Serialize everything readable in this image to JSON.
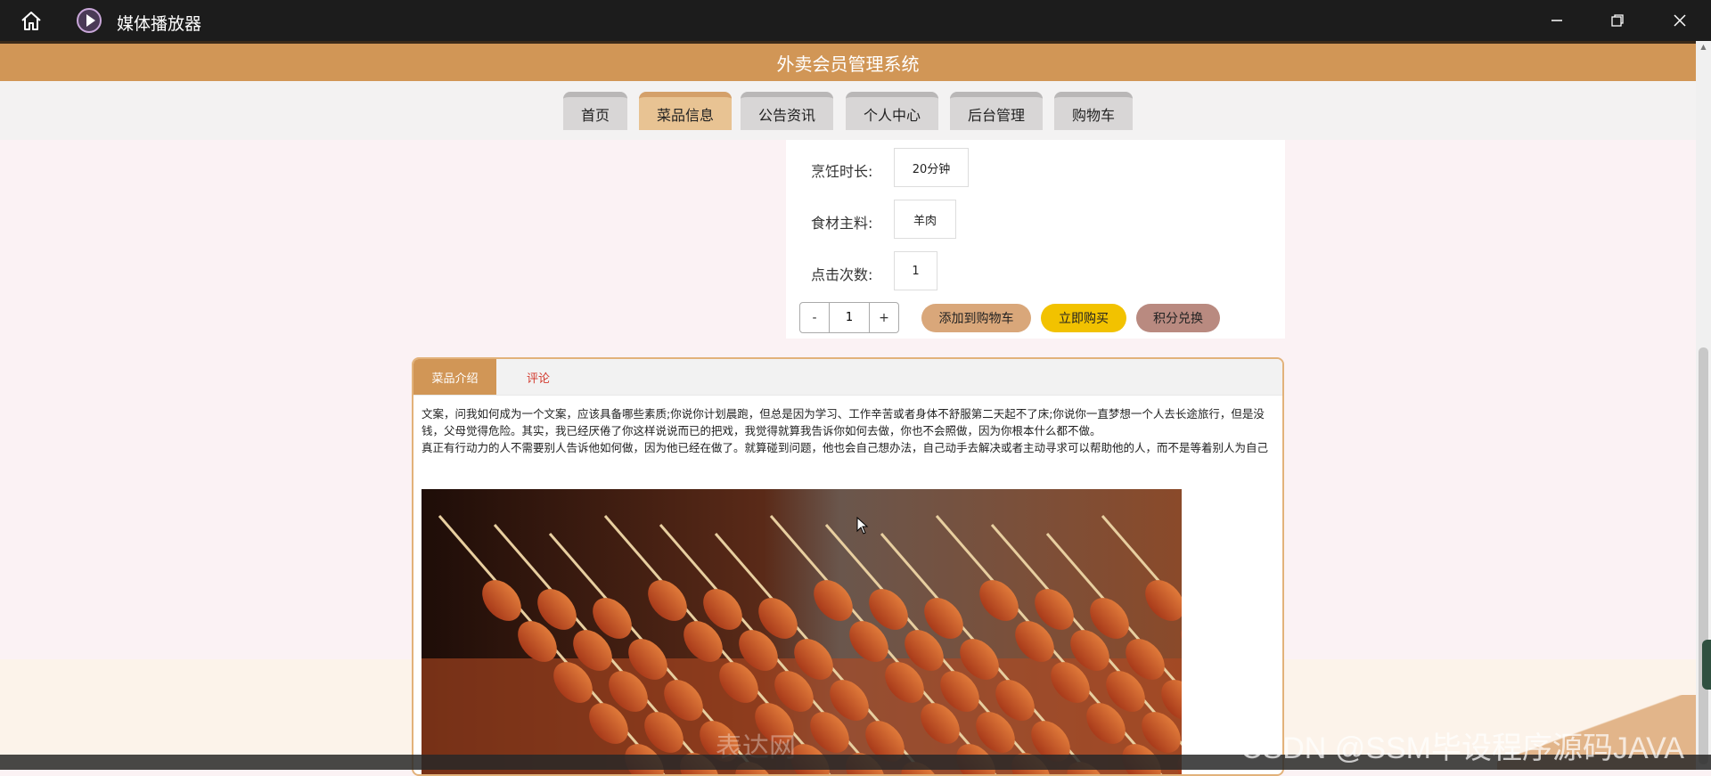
{
  "window": {
    "app_title": "媒体播放器",
    "home_icon": "home-icon",
    "app_icon": "media-player-icon",
    "controls": [
      "minimize-icon",
      "restore-icon",
      "close-icon"
    ]
  },
  "site": {
    "title": "外卖会员管理系统"
  },
  "nav": {
    "items": [
      {
        "label": "首页",
        "active": false
      },
      {
        "label": "菜品信息",
        "active": true
      },
      {
        "label": "公告资讯",
        "active": false
      },
      {
        "label": "个人中心",
        "active": false
      },
      {
        "label": "后台管理",
        "active": false
      },
      {
        "label": "购物车",
        "active": false
      }
    ]
  },
  "dish_info": {
    "cook_time_label": "烹饪时长:",
    "cook_time_value": "20分钟",
    "main_ingredient_label": "食材主料:",
    "main_ingredient_value": "羊肉",
    "clicks_label": "点击次数:",
    "clicks_value": "1"
  },
  "purchase": {
    "minus_label": "-",
    "quantity": "1",
    "plus_label": "+",
    "add_to_cart_label": "添加到购物车",
    "add_to_cart_color": "#d9a77a",
    "buy_now_label": "立即购买",
    "buy_now_color": "#f2c200",
    "points_exchange_label": "积分兑换",
    "points_exchange_color": "#b98a80"
  },
  "detail": {
    "tabs": [
      {
        "label": "菜品介绍",
        "active": true
      },
      {
        "label": "评论",
        "active": false
      }
    ],
    "description_p1": "文案，问我如何成为一个文案，应该具备哪些素质;你说你计划晨跑，但总是因为学习、工作辛苦或者身体不舒服第二天起不了床;你说你一直梦想一个人去长途旅行，但是没钱，父母觉得危险。其实，我已经厌倦了你这样说说而已的把戏，我觉得就算我告诉你如何去做，你也不会照做，因为你根本什么都不做。",
    "description_p2": "真正有行动力的人不需要别人告诉他如何做，因为他已经在做了。就算碰到问题，他也会自己想办法，自己动手去解决或者主动寻求可以帮助他的人，而不是等着别人为自己",
    "photo_watermark": "表达网"
  },
  "watermark": "CSDN @SSM毕设程序源码JAVA",
  "colors": {
    "header": "#d19656",
    "active_tab": "#d19656",
    "nav_active": "#e8c393"
  }
}
